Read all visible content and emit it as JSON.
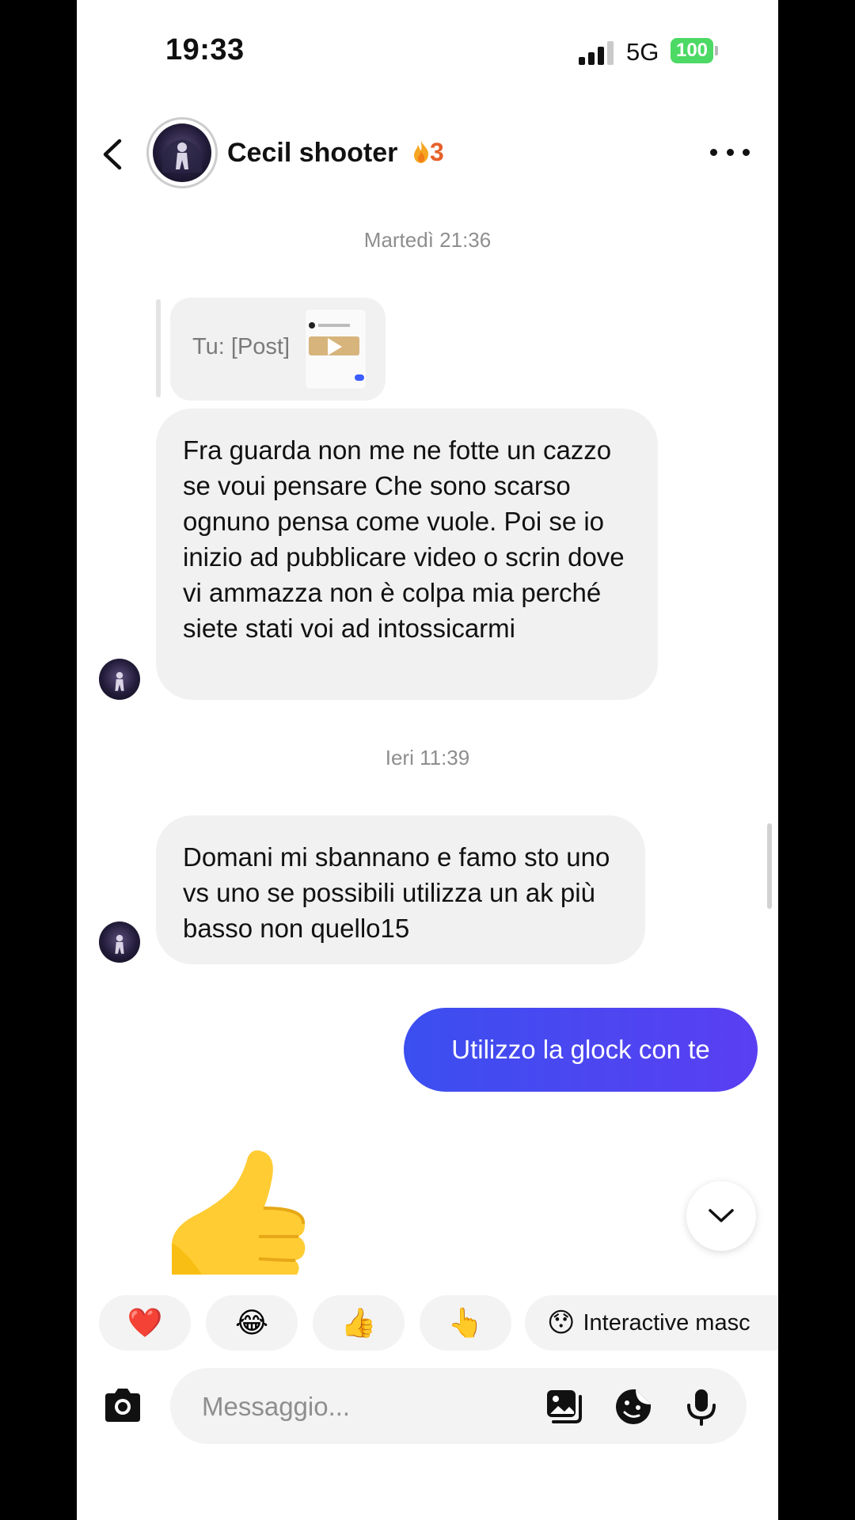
{
  "status_bar": {
    "time": "19:33",
    "network": "5G",
    "battery": "100"
  },
  "header": {
    "name": "Cecil shooter",
    "streak_count": "3",
    "streak_icon": "flame-icon"
  },
  "messages": {
    "timestamp_1": "Martedì 21:36",
    "reply_label": "Tu: [Post]",
    "msg_1": "Fra guarda non me ne fotte un cazzo se voui pensare Che sono scarso ognuno pensa come vuole. Poi se io inizio ad pubblicare video o scrin dove vi ammazza non è colpa mia perché siete stati voi ad intossicarmi",
    "timestamp_2": "Ieri 11:39",
    "msg_2": "Domani mi sbannano e famo sto uno vs uno se possibili utilizza un ak più basso non quello15",
    "msg_out": "Utilizzo la glock con te",
    "sticker": "thumbs-up-emoji"
  },
  "quick_reactions": {
    "heart": "❤️",
    "laugh": "😂",
    "thumbs_up": "👍",
    "point": "👆",
    "interactive_mask_emoji": "😯",
    "interactive_mask_label": "Interactive masc"
  },
  "composer": {
    "placeholder": "Messaggio..."
  },
  "colors": {
    "outgoing_gradient_start": "#3b4ff0",
    "outgoing_gradient_end": "#5a3ff2",
    "incoming_bubble": "#f1f1f1",
    "streak": "#e6602a",
    "battery": "#4cd964"
  }
}
